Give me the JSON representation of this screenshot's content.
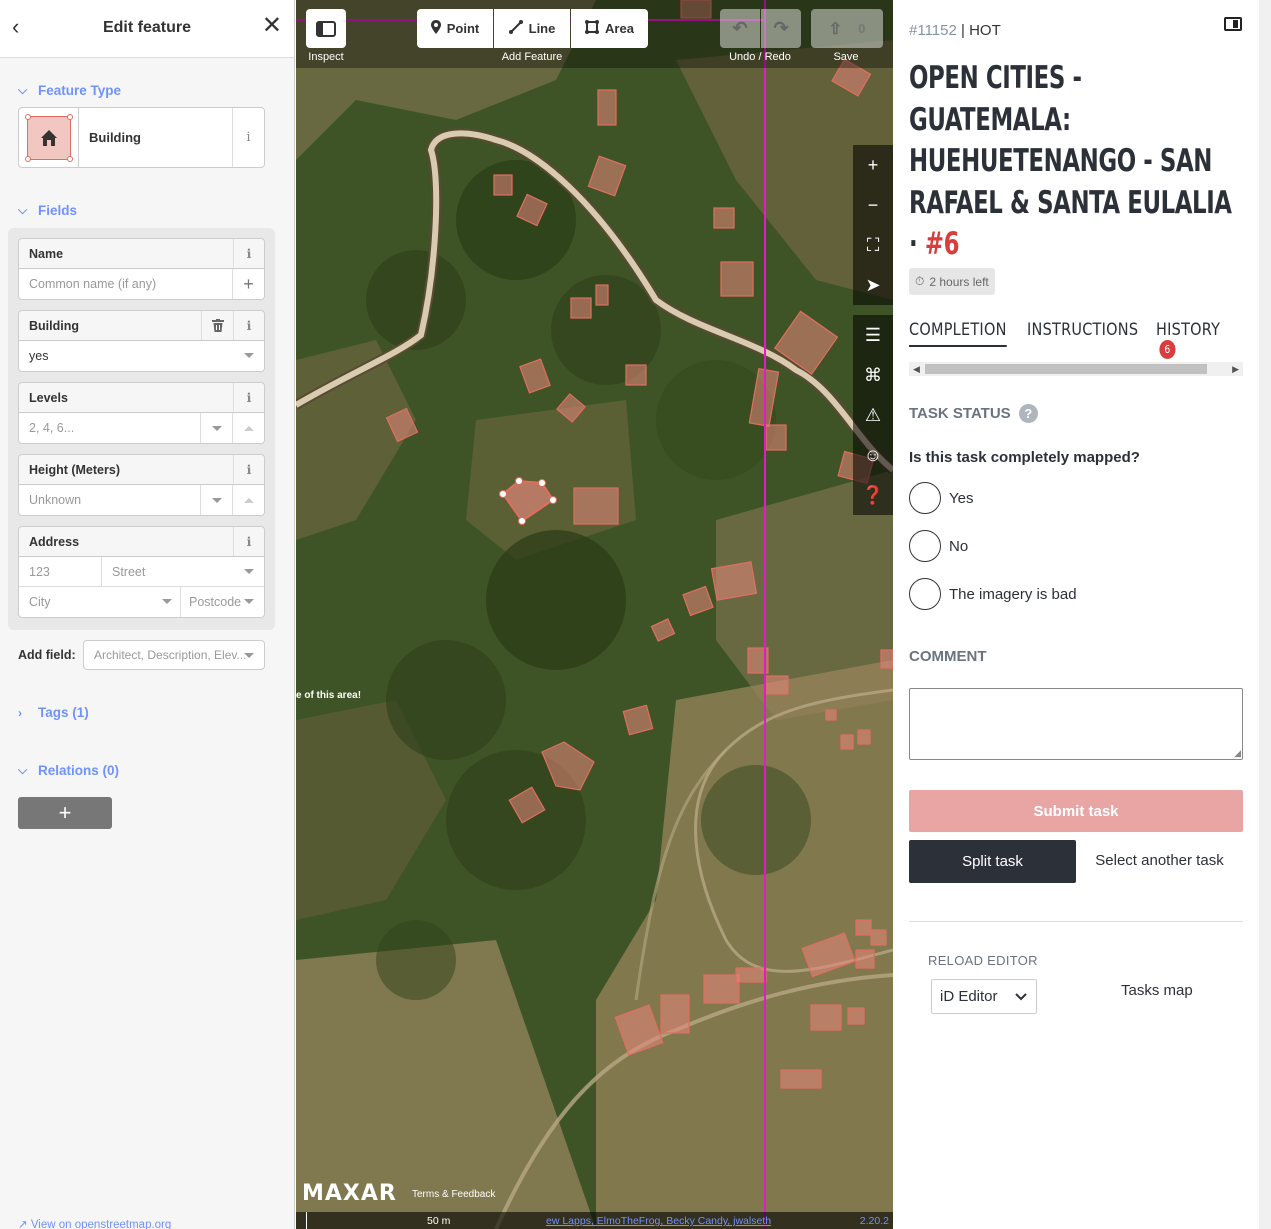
{
  "sidebar": {
    "title": "Edit feature",
    "feature_type_heading": "Feature Type",
    "feature_type_value": "Building",
    "fields_heading": "Fields",
    "fields": {
      "name_label": "Name",
      "name_placeholder": "Common name (if any)",
      "building_label": "Building",
      "building_value": "yes",
      "levels_label": "Levels",
      "levels_placeholder": "2, 4, 6...",
      "height_label": "Height (Meters)",
      "height_placeholder": "Unknown",
      "address_label": "Address",
      "address_number_placeholder": "123",
      "address_street_placeholder": "Street",
      "address_city_placeholder": "City",
      "address_postcode_placeholder": "Postcode"
    },
    "add_field_label": "Add field:",
    "add_field_placeholder": "Architect, Description, Elev...",
    "tags_heading": "Tags (1)",
    "relations_heading": "Relations (0)",
    "relations_add": "+",
    "osm_link": "View on openstreetmap.org"
  },
  "map": {
    "toolbar": {
      "inspect_label": "Inspect",
      "point": "Point",
      "line": "Line",
      "area": "Area",
      "add_feature_label": "Add Feature",
      "undo_redo_label": "Undo / Redo",
      "save_count": "0",
      "save_label": "Save"
    },
    "note": "e of this area!",
    "imagery_logo": "MAXAR",
    "terms": "Terms & Feedback",
    "scale": "50 m",
    "attribution": "ew Lapps, ElmoTheFrog, Becky Candy, jwalseth",
    "version": "2.20.2"
  },
  "panel": {
    "project_id": "#11152",
    "org": "| HOT",
    "title": "OPEN CITIES - GUATEMALA: HUEHUETENANGO - SAN RAFAEL & SANTA EULALIA ·",
    "task_number": "#6",
    "time_left": "2 hours left",
    "tabs": {
      "completion": "COMPLETION",
      "instructions": "INSTRUCTIONS",
      "history": "HISTORY",
      "history_count": "6"
    },
    "task_status_heading": "TASK STATUS",
    "help_icon_text": "?",
    "question": "Is this task completely mapped?",
    "options": {
      "yes": "Yes",
      "no": "No",
      "bad_imagery": "The imagery is bad"
    },
    "comment_heading": "COMMENT",
    "submit": "Submit task",
    "split": "Split task",
    "select_another": "Select another task",
    "reload_heading": "RELOAD EDITOR",
    "editor_value": "iD Editor",
    "tasks_map": "Tasks map"
  },
  "colors": {
    "accent_blue": "#7092ff",
    "task_red": "#d73f3f",
    "submit_disabled": "#e9a4a4",
    "dark": "#2c3038",
    "building_fill": "#f2c7c1",
    "task_boundary": "#e01cc8"
  }
}
